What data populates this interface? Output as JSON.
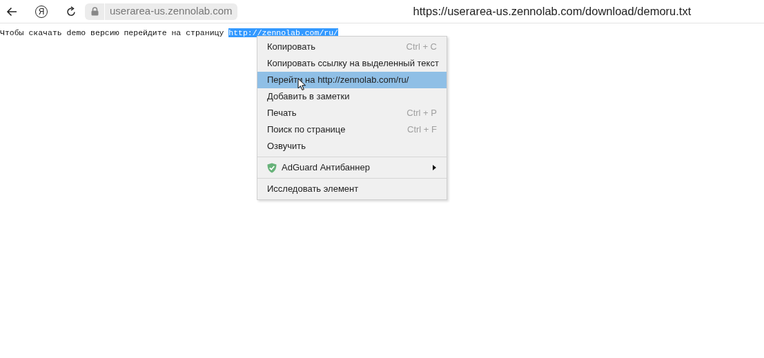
{
  "toolbar": {
    "logo_letter": "Я",
    "domain": "userarea-us.zennolab.com",
    "full_url": "https://userarea-us.zennolab.com/download/demoru.txt"
  },
  "page": {
    "text": "Чтобы скачать demo версию перейдите на страницу ",
    "selected_link": "http://zennolab.com/ru/"
  },
  "context_menu": {
    "groups": [
      {
        "items": [
          {
            "kind": "item",
            "label": "Копировать",
            "shortcut": "Ctrl + C",
            "selected": false
          },
          {
            "kind": "item",
            "label": "Копировать ссылку на выделенный текст",
            "selected": false
          },
          {
            "kind": "item",
            "label": "Перейти на http://zennolab.com/ru/",
            "selected": true
          },
          {
            "kind": "item",
            "label": "Добавить в заметки",
            "selected": false
          },
          {
            "kind": "item",
            "label": "Печать",
            "shortcut": "Ctrl + P",
            "selected": false
          },
          {
            "kind": "item",
            "label": "Поиск по странице",
            "shortcut": "Ctrl + F",
            "selected": false
          },
          {
            "kind": "item",
            "label": "Озвучить",
            "selected": false
          }
        ]
      },
      {
        "items": [
          {
            "kind": "submenu",
            "label": "AdGuard Антибаннер",
            "selected": false
          }
        ]
      },
      {
        "items": [
          {
            "kind": "item",
            "label": "Исследовать элемент",
            "selected": false
          }
        ]
      }
    ]
  }
}
